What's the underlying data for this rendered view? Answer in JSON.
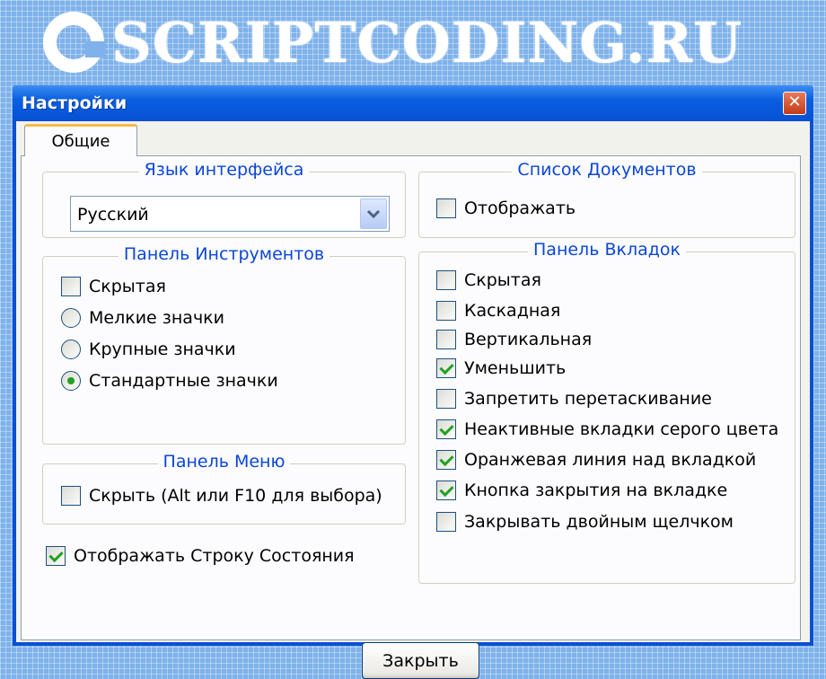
{
  "watermark": {
    "text": "SCRIPTCODING.RU"
  },
  "window": {
    "title": "Настройки",
    "close_glyph": "✕"
  },
  "tabs": [
    {
      "label": "Общие",
      "active": true
    }
  ],
  "language_group": {
    "legend": "Язык интерфейса",
    "select_value": "Русский"
  },
  "toolbar_group": {
    "legend": "Панель Инструментов",
    "hidden": {
      "label": "Скрытая",
      "checked": false
    },
    "radios": [
      {
        "label": "Мелкие значки",
        "checked": false
      },
      {
        "label": "Крупные значки",
        "checked": false
      },
      {
        "label": "Стандартные значки",
        "checked": true
      }
    ]
  },
  "menu_group": {
    "legend": "Панель Меню",
    "hide": {
      "label": "Скрыть (Alt или F10 для выбора)",
      "checked": false
    }
  },
  "statusbar": {
    "label": "Отображать Строку Состояния",
    "checked": true
  },
  "doclist_group": {
    "legend": "Список Документов",
    "show": {
      "label": "Отображать",
      "checked": false
    }
  },
  "tabbar_group": {
    "legend": "Панель Вкладок",
    "items": [
      {
        "label": "Скрытая",
        "checked": false
      },
      {
        "label": "Каскадная",
        "checked": false
      },
      {
        "label": "Вертикальная",
        "checked": false
      },
      {
        "label": "Уменьшить",
        "checked": true
      },
      {
        "label": "Запретить перетаскивание",
        "checked": false
      },
      {
        "label": "Неактивные вкладки серого цвета",
        "checked": true
      },
      {
        "label": "Оранжевая линия над вкладкой",
        "checked": true
      },
      {
        "label": "Кнопка закрытия на вкладке",
        "checked": true
      },
      {
        "label": "Закрывать двойным щелчком",
        "checked": false
      }
    ]
  },
  "footer": {
    "close_label": "Закрыть"
  },
  "colors": {
    "titlebar": "#0a5fe0",
    "legend_text": "#0b46d6",
    "check_mark": "#21a121",
    "tab_highlight": "#f7b94b"
  }
}
